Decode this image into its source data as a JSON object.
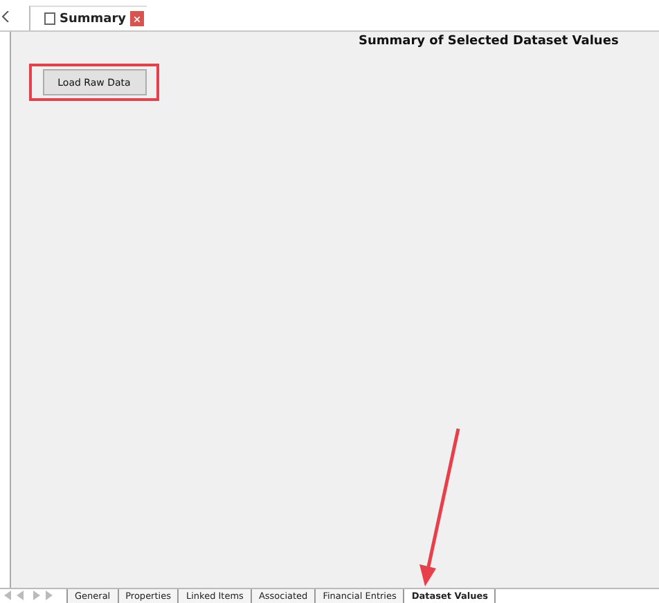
{
  "document_tab": {
    "title": "Summary"
  },
  "panel": {
    "title": "Summary of Selected Dataset Values",
    "button": "Load Raw Data"
  },
  "sheet_tabs": [
    {
      "label": "General",
      "selected": false
    },
    {
      "label": "Properties",
      "selected": false
    },
    {
      "label": "Linked Items",
      "selected": false
    },
    {
      "label": "Associated",
      "selected": false
    },
    {
      "label": "Financial Entries",
      "selected": false
    },
    {
      "label": "Dataset Values",
      "selected": true
    }
  ]
}
